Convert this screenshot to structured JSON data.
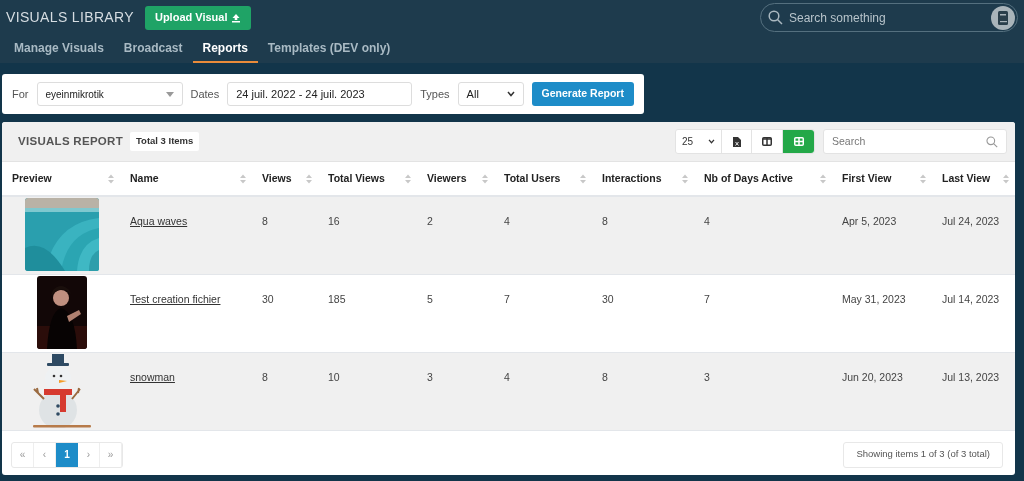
{
  "header": {
    "title": "VISUALS LIBRARY",
    "upload_button": "Upload Visual",
    "search_placeholder": "Search something"
  },
  "tabs": [
    {
      "label": "Manage Visuals",
      "selected": false
    },
    {
      "label": "Broadcast",
      "selected": false
    },
    {
      "label": "Reports",
      "selected": true
    },
    {
      "label": "Templates (DEV only)",
      "selected": false
    }
  ],
  "filter": {
    "for_label": "For",
    "for_value": "eyeinmikrotik",
    "dates_label": "Dates",
    "dates_value": "24 juil. 2022 - 24 juil. 2023",
    "types_label": "Types",
    "types_value": "All",
    "generate_button": "Generate Report"
  },
  "report": {
    "title": "VISUALS REPORT",
    "total_badge": "Total 3 Items",
    "page_size": "25",
    "view_toggles": [
      {
        "kind": "columns",
        "selected": false
      },
      {
        "kind": "grid",
        "selected": true
      }
    ],
    "search_placeholder": "Search"
  },
  "table": {
    "columns": [
      "Preview",
      "Name",
      "Views",
      "Total Views",
      "Viewers",
      "Total Users",
      "Interactions",
      "Nb of Days Active",
      "First View",
      "Last View"
    ],
    "rows": [
      {
        "preview": {
          "kind": "water"
        },
        "cells": [
          "",
          "Aqua waves",
          "8",
          "16",
          "2",
          "4",
          "8",
          "4",
          "Apr 5, 2023",
          "Jul 24, 2023"
        ]
      },
      {
        "preview": {
          "kind": "person"
        },
        "cells": [
          "",
          "Test creation fichier",
          "30",
          "185",
          "5",
          "7",
          "30",
          "7",
          "May 31, 2023",
          "Jul 14, 2023"
        ]
      },
      {
        "preview": {
          "kind": "snowman"
        },
        "cells": [
          "",
          "snowman",
          "8",
          "10",
          "3",
          "4",
          "8",
          "3",
          "Jun 20, 2023",
          "Jul 13, 2023"
        ]
      }
    ]
  },
  "pagination": {
    "buttons": [
      {
        "label": "«",
        "selected": false
      },
      {
        "label": "‹",
        "selected": false
      },
      {
        "label": "1",
        "selected": true
      },
      {
        "label": "›",
        "selected": false
      },
      {
        "label": "»",
        "selected": false
      }
    ],
    "summary": "Showing items 1 of 3 (of 3 total)"
  }
}
